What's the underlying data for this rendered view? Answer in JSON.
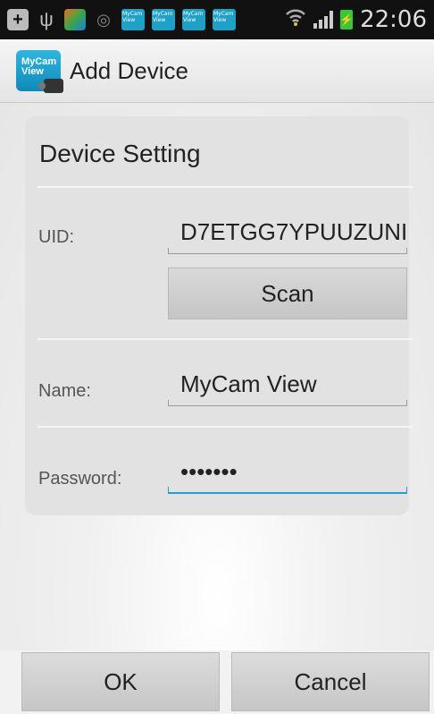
{
  "status_bar": {
    "mini_app_labels": [
      "MyCam View",
      "MyCam View",
      "MyCam View",
      "MyCam View"
    ],
    "time": "22:06"
  },
  "action_bar": {
    "logo_text": "MyCam View",
    "title": "Add Device"
  },
  "card": {
    "title": "Device Setting",
    "uid_label": "UID:",
    "uid_value": "D7ETGG7YPUUZUNI",
    "scan_label": "Scan",
    "name_label": "Name:",
    "name_value": "MyCam View",
    "password_label": "Password:",
    "password_value": "•••••••"
  },
  "buttons": {
    "ok_label": "OK",
    "cancel_label": "Cancel"
  }
}
